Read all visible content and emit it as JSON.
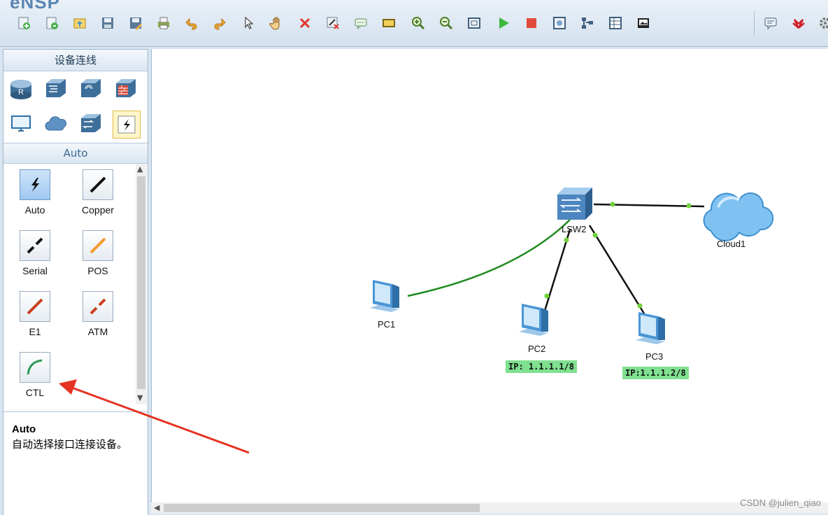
{
  "app": {
    "logo_text": "eNSP"
  },
  "toolbar": {
    "tools": [
      "new-topology-icon",
      "new-example-icon",
      "open-icon",
      "save-icon",
      "save-as-icon",
      "print-icon",
      "undo-icon",
      "redo-icon",
      "select-icon",
      "pan-hand-icon",
      "delete-icon",
      "delete-connection-icon",
      "text-annotation-icon",
      "rectangle-icon",
      "zoom-in-icon",
      "zoom-out-icon",
      "fit-icon",
      "start-device-icon",
      "stop-device-icon",
      "capture-icon",
      "topology-icon",
      "grid-icon",
      "screenshot-icon",
      "chat-icon",
      "huawei-icon",
      "settings-icon"
    ]
  },
  "left_panel": {
    "title": "设备连线",
    "subtitle": "Auto",
    "cables": [
      {
        "label": "Auto",
        "color": "#1b1b1b"
      },
      {
        "label": "Copper",
        "color": "#111111"
      },
      {
        "label": "Serial",
        "color": "#111111"
      },
      {
        "label": "POS",
        "color": "#f39a2e"
      },
      {
        "label": "E1",
        "color": "#c9401d"
      },
      {
        "label": "ATM",
        "color": "#c9401d"
      },
      {
        "label": "CTL",
        "color": "#2e9a5a"
      }
    ],
    "description": {
      "title": "Auto",
      "text": "自动选择接口连接设备。"
    }
  },
  "topology": {
    "nodes": {
      "lsw2": "LSW2",
      "cloud1": "Cloud1",
      "pc1": "PC1",
      "pc2": "PC2",
      "pc3": "PC3"
    },
    "pc2_ip": "IP: 1.1.1.1/8",
    "pc3_ip": "IP:1.1.1.2/8",
    "link_colors": {
      "ctl": "#1e8a1e",
      "copper": "#111111",
      "port": "#6fd23a"
    }
  },
  "annotation": {
    "arrow_color": "#e53323"
  },
  "watermark": "CSDN @julien_qiao"
}
